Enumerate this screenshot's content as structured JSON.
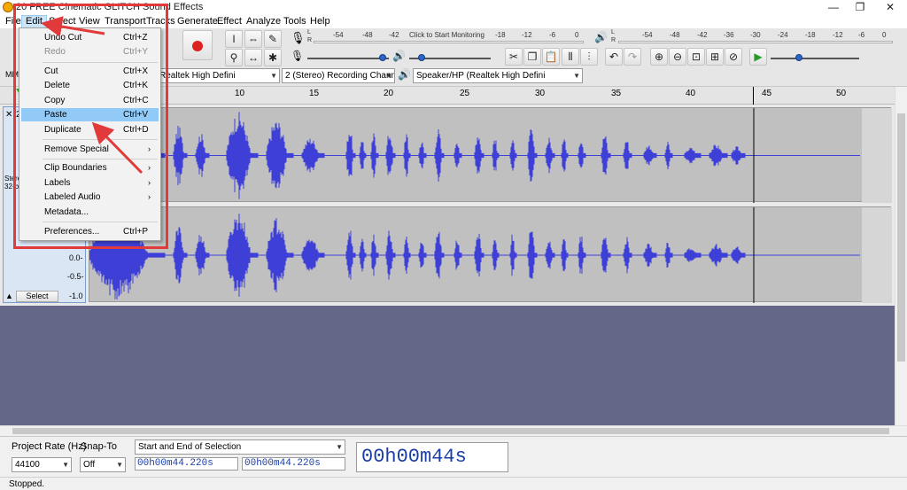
{
  "window": {
    "title": "20 FREE Cinematic GLITCH Sound Effects",
    "minimize": "—",
    "restore": "❐",
    "close": "✕"
  },
  "menubar": [
    "File",
    "Edit",
    "Select",
    "View",
    "Transport",
    "Tracks",
    "Generate",
    "Effect",
    "Analyze",
    "Tools",
    "Help"
  ],
  "meters": {
    "record_scale": [
      "-54",
      "-48",
      "-42",
      "Click to Start Monitoring",
      "-18",
      "-12",
      "-6",
      "0"
    ],
    "play_scale": [
      "-54",
      "-48",
      "-42",
      "-36",
      "-30",
      "-24",
      "-18",
      "-12",
      "-6",
      "0"
    ],
    "L": "L",
    "R": "R"
  },
  "devices": {
    "host": "MME",
    "input": "Realtek High Defini",
    "channels": "2 (Stereo) Recording Chann",
    "output": "Speaker/HP (Realtek High Defini"
  },
  "ruler": {
    "ticks": [
      "10",
      "15",
      "20",
      "25",
      "30",
      "35",
      "40",
      "45",
      "50"
    ]
  },
  "track": {
    "close": "✕",
    "name": "2",
    "info1": "Stere",
    "info2": "32-bi",
    "amp_labels": [
      "0.0-",
      "-0.5-",
      "-1.0"
    ],
    "select_button": "Select",
    "collapse": "▲"
  },
  "edit_menu": {
    "items": [
      {
        "label": "Undo Cut",
        "shortcut": "Ctrl+Z"
      },
      {
        "label": "Redo",
        "shortcut": "Ctrl+Y"
      },
      {
        "label": "Cut",
        "shortcut": "Ctrl+X"
      },
      {
        "label": "Delete",
        "shortcut": "Ctrl+K"
      },
      {
        "label": "Copy",
        "shortcut": "Ctrl+C"
      },
      {
        "label": "Paste",
        "shortcut": "Ctrl+V"
      },
      {
        "label": "Duplicate",
        "shortcut": "Ctrl+D"
      },
      {
        "label": "Remove Special",
        "shortcut": ""
      },
      {
        "label": "Clip Boundaries",
        "shortcut": ""
      },
      {
        "label": "Labels",
        "shortcut": ""
      },
      {
        "label": "Labeled Audio",
        "shortcut": ""
      },
      {
        "label": "Metadata...",
        "shortcut": ""
      },
      {
        "label": "Preferences...",
        "shortcut": "Ctrl+P"
      }
    ],
    "submenu_arrow": "›"
  },
  "selection_toolbar": {
    "project_rate_label": "Project Rate (Hz)",
    "project_rate_value": "44100",
    "snap_to_label": "Snap-To",
    "snap_to_value": "Off",
    "selection_mode": "Start and End of Selection",
    "start_time": "00h00m44.220s",
    "end_time": "00h00m44.220s",
    "audio_position": "00h00m44s"
  },
  "status": "Stopped.",
  "colors": {
    "waveform": "#3d3fd6",
    "accent_annotation": "#e23a3a",
    "menu_highlight": "#91c9f7"
  }
}
